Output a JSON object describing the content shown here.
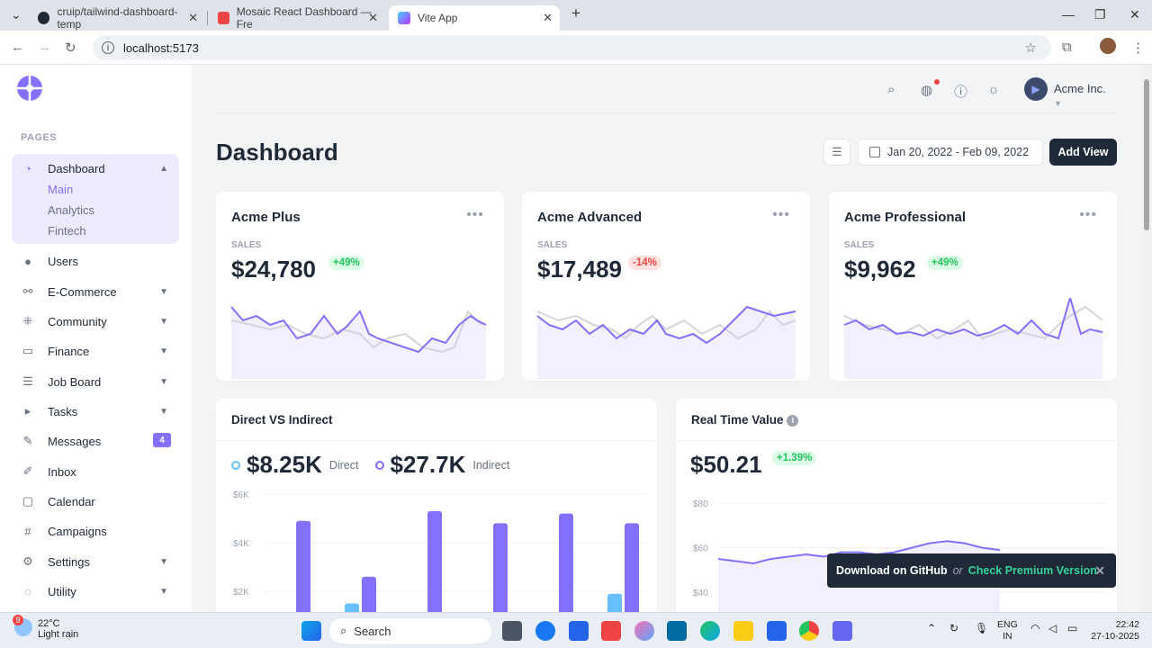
{
  "browser": {
    "tabs": [
      {
        "label": "cruip/tailwind-dashboard-temp",
        "active": false
      },
      {
        "label": "Mosaic React Dashboard — Fre",
        "active": false
      },
      {
        "label": "Vite App",
        "active": true
      }
    ],
    "address": "localhost:5173"
  },
  "sidebar": {
    "section_label": "PAGES",
    "items": [
      {
        "label": "Dashboard",
        "icon": "dashboard-icon"
      },
      {
        "label": "Users",
        "icon": "user-icon"
      },
      {
        "label": "E-Commerce",
        "icon": "ecommerce-icon"
      },
      {
        "label": "Community",
        "icon": "community-icon"
      },
      {
        "label": "Finance",
        "icon": "finance-icon"
      },
      {
        "label": "Job Board",
        "icon": "job-board-icon"
      },
      {
        "label": "Tasks",
        "icon": "tasks-icon"
      },
      {
        "label": "Messages",
        "icon": "messages-icon",
        "badge": "4"
      },
      {
        "label": "Inbox",
        "icon": "inbox-icon"
      },
      {
        "label": "Calendar",
        "icon": "calendar-icon"
      },
      {
        "label": "Campaigns",
        "icon": "campaigns-icon"
      },
      {
        "label": "Settings",
        "icon": "settings-icon"
      },
      {
        "label": "Utility",
        "icon": "utility-icon"
      }
    ],
    "dashboard_sub": [
      "Main",
      "Analytics",
      "Fintech"
    ]
  },
  "header": {
    "org_name": "Acme Inc."
  },
  "main": {
    "title": "Dashboard",
    "date_range": "Jan 20, 2022 - Feb 09, 2022",
    "add_view_label": "Add View",
    "cards": [
      {
        "name": "Acme Plus",
        "label": "SALES",
        "amount": "$24,780",
        "change": "+49%",
        "trend": "up"
      },
      {
        "name": "Acme Advanced",
        "label": "SALES",
        "amount": "$17,489",
        "change": "-14%",
        "trend": "down"
      },
      {
        "name": "Acme Professional",
        "label": "SALES",
        "amount": "$9,962",
        "change": "+49%",
        "trend": "up"
      }
    ],
    "direct_vs_indirect": {
      "title": "Direct VS Indirect",
      "direct_value": "$8.25K",
      "direct_label": "Direct",
      "indirect_value": "$27.7K",
      "indirect_label": "Indirect"
    },
    "realtime": {
      "title": "Real Time Value",
      "value": "$50.21",
      "change": "+1.39%"
    }
  },
  "toast": {
    "download": "Download on GitHub",
    "or": "or",
    "premium": "Check Premium Version"
  },
  "taskbar": {
    "temp": "22°C",
    "weather": "Light rain",
    "search": "Search",
    "lang1": "ENG",
    "lang2": "IN",
    "time": "22:42",
    "date": "27-10-2025",
    "weather_badge": "9"
  },
  "colors": {
    "accent": "#8470ff",
    "sky": "#67bfff",
    "positive": "#22c55e",
    "negative": "#ef4444",
    "dark": "#1f2937"
  },
  "chart_data": [
    {
      "type": "bar",
      "title": "Direct VS Indirect",
      "series": [
        {
          "name": "Direct",
          "values": [
            0,
            1.5,
            0,
            0.1,
            0,
            1.9,
            1.7
          ]
        },
        {
          "name": "Indirect",
          "values": [
            4.9,
            2.6,
            5.3,
            4.8,
            5.2,
            4.8,
            0
          ]
        }
      ],
      "y_ticks": [
        "$6K",
        "$4K",
        "$2K"
      ],
      "ylim": [
        0,
        6
      ]
    },
    {
      "type": "line",
      "title": "Real Time Value",
      "series": [
        {
          "values": [
            55,
            54,
            53,
            55,
            56,
            57,
            56,
            58,
            58,
            57,
            58,
            60,
            62,
            63,
            62,
            60,
            59
          ]
        }
      ],
      "y_ticks": [
        "$80",
        "$60",
        "$40"
      ],
      "ylim": [
        40,
        80
      ]
    }
  ]
}
